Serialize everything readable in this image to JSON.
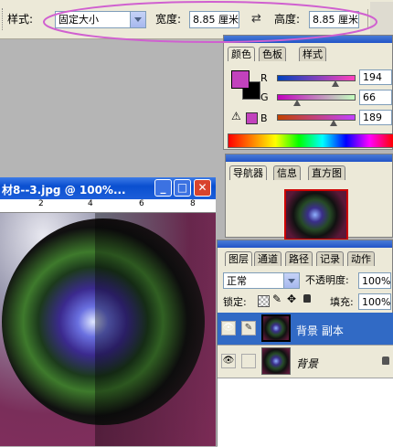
{
  "options_bar": {
    "style_label": "样式:",
    "style_value": "固定大小",
    "width_label": "宽度:",
    "width_value": "8.85 厘米",
    "swap_icon": "swap-arrows-icon",
    "height_label": "高度:",
    "height_value": "8.85 厘米"
  },
  "color_palette": {
    "tabs": [
      "颜色",
      "色板",
      "样式"
    ],
    "channels": [
      {
        "label": "R",
        "value": "194",
        "fraction": 0.76
      },
      {
        "label": "G",
        "value": "66",
        "fraction": 0.26
      },
      {
        "label": "B",
        "value": "189",
        "fraction": 0.74
      }
    ],
    "foreground_color": "#c242bd",
    "background_color": "#000000",
    "warning_icon": "gamut-warning-icon"
  },
  "navigator_palette": {
    "tabs": [
      "导航器",
      "信息",
      "直方图"
    ]
  },
  "document": {
    "title": "材8--3.jpg @ 100%...",
    "ruler_marks": [
      "2",
      "4",
      "6",
      "8"
    ]
  },
  "layers_palette": {
    "tabs": [
      "图层",
      "通道",
      "路径",
      "记录",
      "动作"
    ],
    "blend_mode": "正常",
    "opacity_label": "不透明度:",
    "opacity_value": "100%",
    "lock_label": "锁定:",
    "fill_label": "填充:",
    "fill_value": "100%",
    "layers": [
      {
        "name": "背景 副本",
        "selected": true
      },
      {
        "name": "背景",
        "selected": false,
        "italic": true
      }
    ]
  },
  "annotation_color": "#d060d0"
}
